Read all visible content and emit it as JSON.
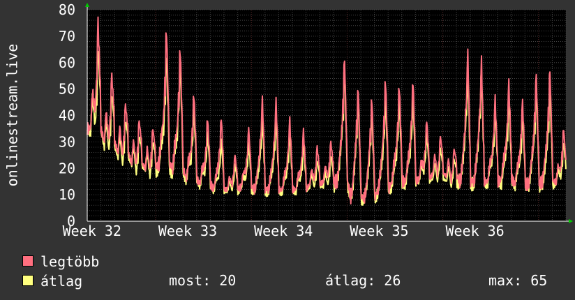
{
  "chart_data": {
    "type": "line",
    "ylabel": "onlinestream.live",
    "ylim": [
      0,
      80
    ],
    "yticks": [
      0,
      10,
      20,
      30,
      40,
      50,
      60,
      70,
      80
    ],
    "x_tick_labels": [
      "Week 32",
      "Week 33",
      "Week 34",
      "Week 35",
      "Week 36"
    ],
    "grid": true,
    "colors": {
      "background": "#333333",
      "plot_background": "#000000",
      "grid": "#444444",
      "grid_major": "#5a2a2a",
      "axis": "#ffffff",
      "arrow": "#00cc00"
    },
    "days": 35,
    "series": [
      {
        "name": "legtöbb",
        "color": "#ff6f7f",
        "daily_peaks": [
          75,
          55,
          44,
          38,
          35,
          72,
          65,
          48,
          39,
          39,
          25,
          35,
          46,
          45,
          38,
          34,
          28,
          30,
          61,
          50,
          46,
          53,
          51,
          53,
          38,
          32,
          27,
          63,
          60,
          46,
          52,
          45,
          55,
          57,
          35
        ],
        "daily_lows": [
          35,
          30,
          26,
          22,
          20,
          22,
          20,
          16,
          14,
          12,
          12,
          13,
          12,
          12,
          12,
          12,
          14,
          15,
          15,
          9,
          9,
          12,
          15,
          15,
          16,
          18,
          17,
          15,
          15,
          15,
          16,
          14,
          14,
          15,
          15
        ]
      },
      {
        "name": "átlag",
        "color": "#ffff7f",
        "daily_peaks": [
          65,
          48,
          38,
          32,
          30,
          63,
          60,
          42,
          33,
          30,
          21,
          29,
          39,
          39,
          33,
          29,
          23,
          25,
          57,
          46,
          41,
          46,
          45,
          46,
          33,
          27,
          23,
          57,
          57,
          42,
          46,
          39,
          50,
          50,
          30
        ],
        "daily_lows": [
          34,
          28,
          24,
          21,
          19,
          20,
          18,
          15,
          13,
          11,
          11,
          12,
          11,
          11,
          11,
          11,
          13,
          13,
          14,
          8,
          8,
          11,
          13,
          14,
          15,
          16,
          15,
          14,
          14,
          14,
          14,
          13,
          13,
          13,
          14
        ]
      }
    ]
  },
  "legend": [
    {
      "label": "legtöbb",
      "color": "#ff6f7f"
    },
    {
      "label": "átlag",
      "color": "#ffff7f"
    }
  ],
  "stats": {
    "now": "most: 20",
    "avg": "átlag: 26",
    "max": "max: 65"
  }
}
